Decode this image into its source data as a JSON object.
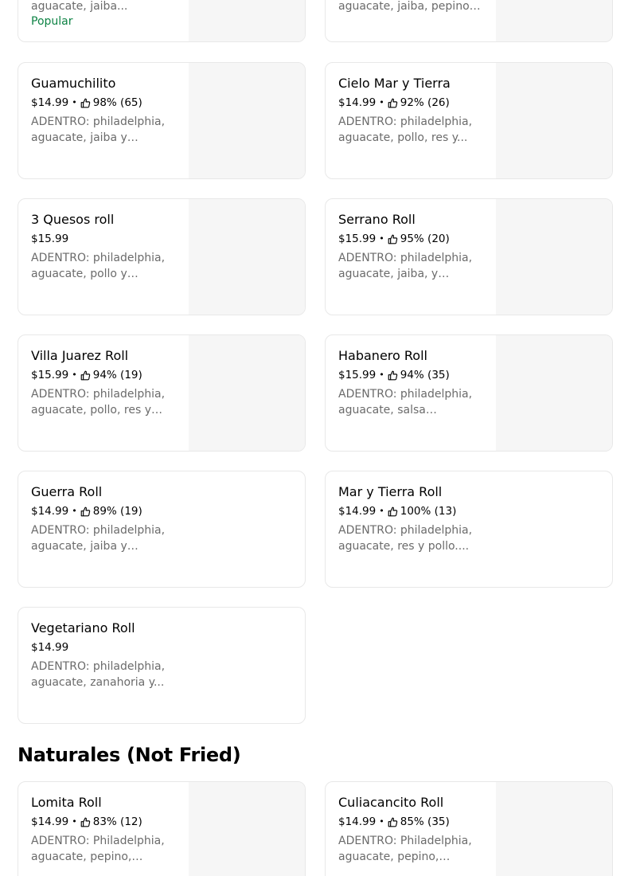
{
  "top_cards": [
    {
      "desc": "aguacate, jaiba...",
      "badge": "Popular"
    },
    {
      "desc": "aguacate, jaiba, pepino y..."
    }
  ],
  "items": [
    {
      "name": "Guamuchilito",
      "price": "$14.99",
      "rating": "98% (65)",
      "desc": "ADENTRO: philadelphia, aguacate, jaiba y camarón...",
      "has_image": true
    },
    {
      "name": "Cielo Mar y Tierra",
      "price": "$14.99",
      "rating": "92% (26)",
      "desc": "ADENTRO: philadelphia, aguacate, pollo, res y...",
      "has_image": true
    },
    {
      "name": "3 Quesos roll",
      "price": "$15.99",
      "rating": null,
      "desc": "ADENTRO: philadelphia, aguacate, pollo y camarón...",
      "has_image": true
    },
    {
      "name": "Serrano Roll",
      "price": "$15.99",
      "rating": "95% (20)",
      "desc": "ADENTRO: philadelphia, aguacate, jaiba, y pepino....",
      "has_image": true
    },
    {
      "name": "Villa Juarez Roll",
      "price": "$15.99",
      "rating": "94% (19)",
      "desc": "ADENTRO: philadelphia, aguacate, pollo, res y tocin...",
      "has_image": true
    },
    {
      "name": "Habanero Roll",
      "price": "$15.99",
      "rating": "94% (35)",
      "desc": "ADENTRO: philadelphia, aguacate, salsa habanero,...",
      "has_image": true
    },
    {
      "name": "Guerra Roll",
      "price": "$14.99",
      "rating": "89% (19)",
      "desc": "ADENTRO: philadelphia, aguacate, jaiba y pepino....",
      "has_image": false
    },
    {
      "name": "Mar y Tierra Roll",
      "price": "$14.99",
      "rating": "100% (13)",
      "desc": "ADENTRO: philadelphia, aguacate, res y pollo....",
      "has_image": false
    },
    {
      "name": "Vegetariano Roll",
      "price": "$14.99",
      "rating": null,
      "desc": "ADENTRO: philadelphia, aguacate, zanahoria y...",
      "has_image": false
    }
  ],
  "section": {
    "title": "Naturales (Not Fried)"
  },
  "section_items": [
    {
      "name": "Lomita Roll",
      "price": "$14.99",
      "rating": "83% (12)",
      "desc": "ADENTRO: Philadelphia, aguacate, pepino, Camero...",
      "has_image": true
    },
    {
      "name": "Culiacancito Roll",
      "price": "$14.99",
      "rating": "85% (35)",
      "desc": "ADENTRO: Philadelphia, aguacate, pepino, camaro...",
      "has_image": true
    }
  ],
  "icons": {
    "rating": "thumbs-up-icon"
  },
  "colors": {
    "popular": "#0e8345",
    "card_border": "#e8e8e8",
    "thumb_bg": "#f6f6f6",
    "desc": "#6b6b6b"
  }
}
